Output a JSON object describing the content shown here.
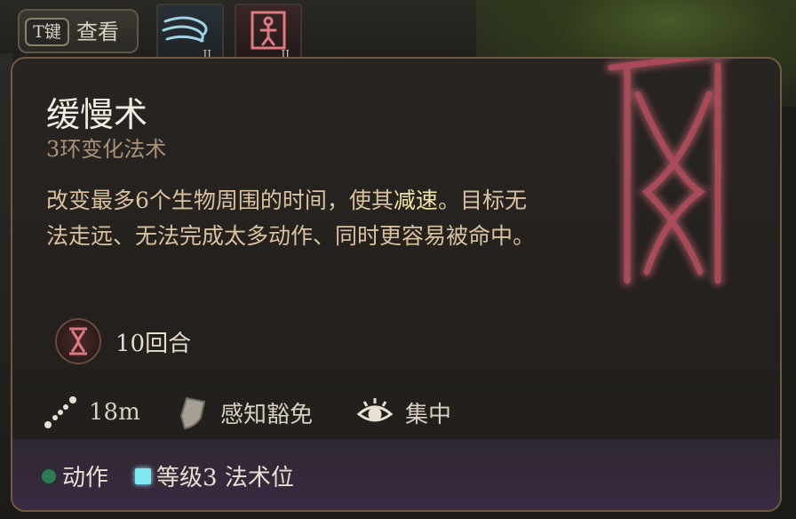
{
  "hotkey": {
    "key": "T键",
    "label": "查看"
  },
  "hotbar": {
    "slot1_tier": "II",
    "slot2_tier": "II"
  },
  "spell": {
    "name": "缓慢术",
    "subtitle": "3环变化法术",
    "description_parts": [
      "改变最多6个生物周围的时间，使其",
      "减速",
      "。目标无法走远、无法完成太多动作、同时更容易被命中。"
    ],
    "duration": "10回合",
    "range": "18m",
    "save": "感知豁免",
    "concentration": "集中",
    "cost_action": "动作",
    "cost_slot": "等级3 法术位"
  },
  "colors": {
    "accent_highlight": "#f1e4a8",
    "action_dot": "#2f7a55",
    "spell_slot": "#7fe6f2",
    "rune_glow": "#d66a7a"
  },
  "icons": {
    "spell_icon": "hourglass-rune-icon",
    "range_icon": "range-dots-icon",
    "save_icon": "shield-icon",
    "concentration_icon": "eye-icon"
  }
}
